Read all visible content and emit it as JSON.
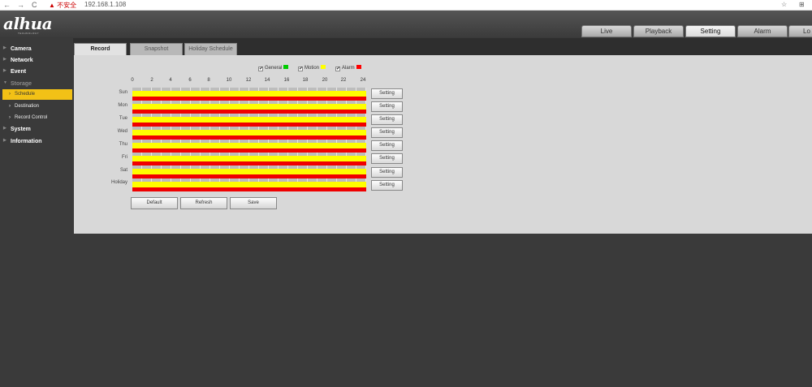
{
  "browser": {
    "back": "←",
    "forward": "→",
    "reload": "C",
    "warning": "▲ 不安全",
    "url": "192.168.1.108",
    "star": "☆",
    "menu": "⊞"
  },
  "brand": {
    "logo": "alhua",
    "tagline": "TECHNOLOGY"
  },
  "top_tabs": [
    {
      "label": "Live"
    },
    {
      "label": "Playback"
    },
    {
      "label": "Setting",
      "active": true
    },
    {
      "label": "Alarm"
    },
    {
      "label": "Lo"
    }
  ],
  "sidebar": {
    "items": [
      {
        "label": "Camera"
      },
      {
        "label": "Network"
      },
      {
        "label": "Event"
      },
      {
        "label": "Storage",
        "expanded": true
      },
      {
        "label": "System"
      },
      {
        "label": "Information"
      }
    ],
    "sub_items": [
      {
        "label": "Schedule",
        "active": true
      },
      {
        "label": "Destination"
      },
      {
        "label": "Record Control"
      }
    ]
  },
  "sub_tabs": [
    {
      "label": "Record",
      "active": true
    },
    {
      "label": "Snapshot"
    },
    {
      "label": "Holiday Schedule"
    }
  ],
  "legend": [
    {
      "label": "General",
      "checked": true,
      "color": "#00cc00"
    },
    {
      "label": "Motion",
      "checked": true,
      "color": "#ffff00"
    },
    {
      "label": "Alarm",
      "checked": true,
      "color": "#ff0000"
    }
  ],
  "hours": [
    "0",
    "2",
    "4",
    "6",
    "8",
    "10",
    "12",
    "14",
    "16",
    "18",
    "20",
    "22",
    "24"
  ],
  "days": [
    "Sun",
    "Mon",
    "Tue",
    "Wed",
    "Thu",
    "Fri",
    "Sat",
    "Holiday"
  ],
  "setting_label": "Setting",
  "actions": {
    "default": "Default",
    "refresh": "Refresh",
    "save": "Save"
  }
}
